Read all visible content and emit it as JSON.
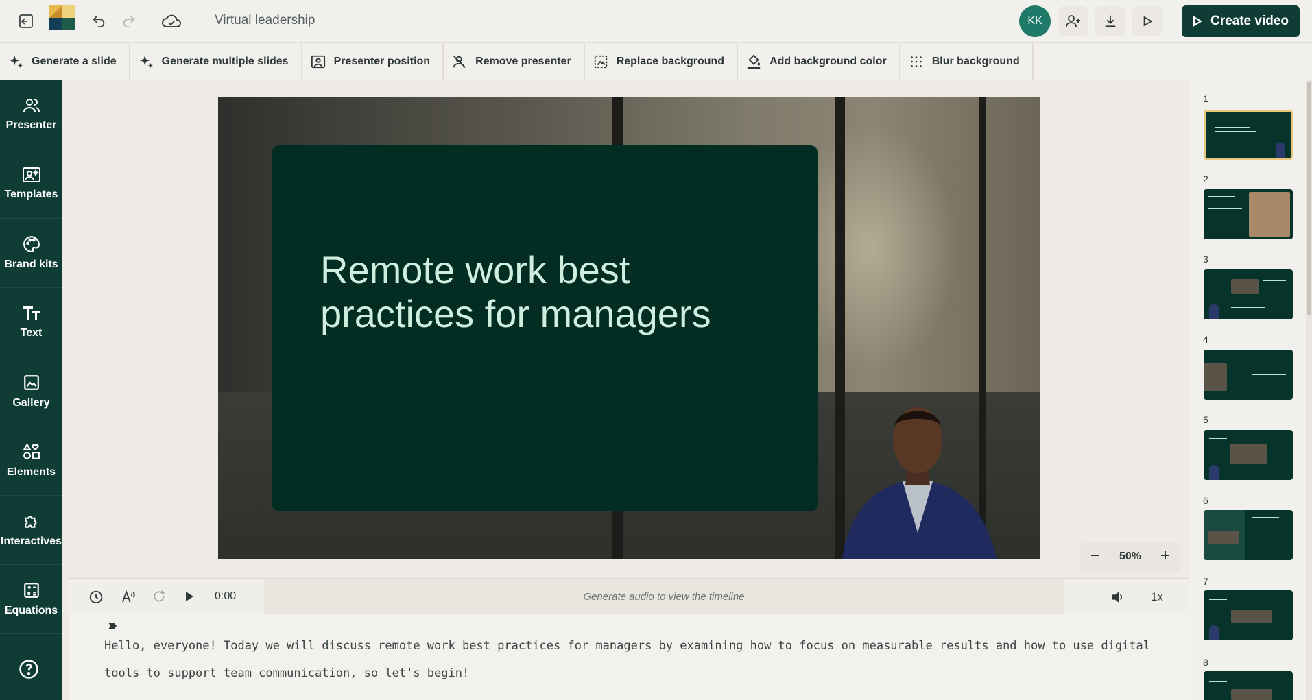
{
  "header": {
    "title": "Virtual leadership",
    "avatar_initials": "KK",
    "create_label": "Create video",
    "brand_color": "#0f3d36",
    "avatar_color": "#1f7a6a"
  },
  "toolbar": {
    "items": [
      {
        "label": "Generate a slide",
        "icon": "sparkle-icon"
      },
      {
        "label": "Generate multiple slides",
        "icon": "sparkle-icon"
      },
      {
        "label": "Presenter position",
        "icon": "presenter-position-icon"
      },
      {
        "label": "Remove presenter",
        "icon": "remove-presenter-icon"
      },
      {
        "label": "Replace background",
        "icon": "replace-background-icon"
      },
      {
        "label": "Add background color",
        "icon": "paint-bucket-icon"
      },
      {
        "label": "Blur background",
        "icon": "blur-icon"
      }
    ]
  },
  "sidebar": {
    "items": [
      {
        "label": "Presenter",
        "icon": "people-icon"
      },
      {
        "label": "Templates",
        "icon": "templates-icon"
      },
      {
        "label": "Brand kits",
        "icon": "palette-icon"
      },
      {
        "label": "Text",
        "icon": "text-icon"
      },
      {
        "label": "Gallery",
        "icon": "image-icon"
      },
      {
        "label": "Elements",
        "icon": "shapes-icon"
      },
      {
        "label": "Interactives",
        "icon": "puzzle-icon"
      },
      {
        "label": "Equations",
        "icon": "calculator-icon"
      }
    ]
  },
  "slide": {
    "title": "Remote work best practices for managers",
    "card_color": "#032c22",
    "title_color": "#cfeee0"
  },
  "zoom": {
    "value": "50%"
  },
  "timeline": {
    "time": "0:00",
    "placeholder": "Generate audio to view the timeline",
    "speed": "1x"
  },
  "script": {
    "text": "Hello, everyone! Today we will discuss remote work best practices for managers by examining how to focus on measurable results and how to use digital tools to support team communication, so let's begin!"
  },
  "slides_panel": {
    "numbers": [
      "1",
      "2",
      "3",
      "4",
      "5",
      "6",
      "7",
      "8"
    ],
    "active": "1"
  }
}
